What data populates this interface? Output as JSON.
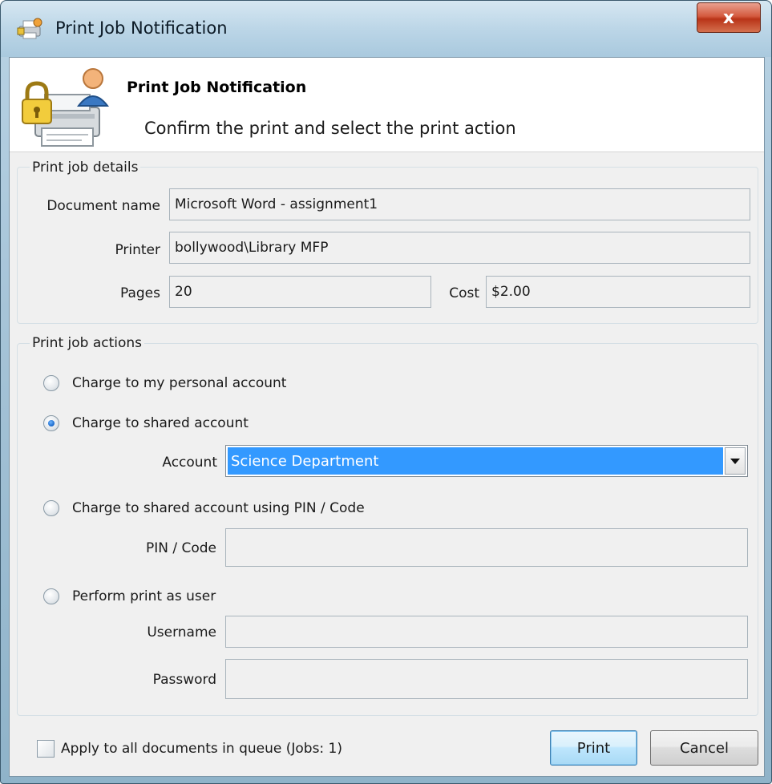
{
  "window": {
    "title": "Print Job Notification",
    "close_glyph": "x"
  },
  "banner": {
    "title": "Print Job Notification",
    "subtitle": "Confirm the print and select the print action"
  },
  "details": {
    "group_label": "Print job details",
    "document_name_label": "Document name",
    "document_name_value": "Microsoft Word - assignment1",
    "printer_label": "Printer",
    "printer_value": "bollywood\\Library MFP",
    "pages_label": "Pages",
    "pages_value": "20",
    "cost_label": "Cost",
    "cost_value": "$2.00"
  },
  "actions": {
    "group_label": "Print job actions",
    "options": [
      {
        "label": "Charge to my personal account",
        "checked": false
      },
      {
        "label": "Charge to shared account",
        "checked": true
      },
      {
        "label": "Charge to shared account using PIN / Code",
        "checked": false
      },
      {
        "label": "Perform print as user",
        "checked": false
      }
    ],
    "account_label": "Account",
    "account_value": "Science Department",
    "pin_label": "PIN / Code",
    "pin_value": "",
    "username_label": "Username",
    "username_value": "",
    "password_label": "Password",
    "password_value": ""
  },
  "footer": {
    "apply_all_label": "Apply to all documents in queue (Jobs: 1)",
    "apply_all_checked": false,
    "print_label": "Print",
    "cancel_label": "Cancel"
  },
  "icons": {
    "title_icon": "printer-lock-icon",
    "banner_icon": "printer-user-lock-icon",
    "close_icon": "close-icon",
    "dropdown_icon": "chevron-down-icon"
  },
  "colors": {
    "selection": "#3399ff",
    "window_frame": "#a6c4d8",
    "close_button": "#c84a2e"
  }
}
